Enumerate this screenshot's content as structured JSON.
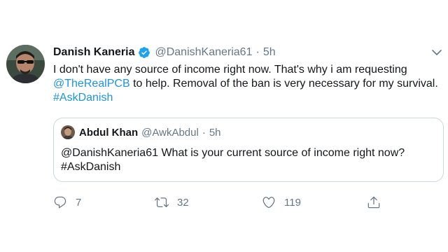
{
  "tweet": {
    "author_name": "Danish Kaneria",
    "author_handle": "@DanishKaneria61",
    "separator": "·",
    "time": "5h",
    "text_line1": "I don't have any source of income right now. That's why i am requesting",
    "mention": "@TheRealPCB",
    "text_line2_rest": " to help. Removal of the ban is very necessary for my survival.",
    "hashtag": "#AskDanish",
    "icons": {
      "verified": "verified-icon",
      "more": "chevron-down-icon",
      "reply": "reply-icon",
      "retweet": "retweet-icon",
      "like": "heart-icon",
      "share": "share-icon"
    },
    "colors": {
      "link": "#1b95e0",
      "muted": "#657786",
      "text": "#14171a",
      "border": "#ccd6dd"
    }
  },
  "quoted": {
    "author_name": "Abdul Khan",
    "author_handle": "@AwkAbdul",
    "separator": "·",
    "time": "5h",
    "text_line1": "@DanishKaneria61 What is your current source of income right now?",
    "text_line2": "#AskDanish"
  },
  "actions": {
    "replies": "7",
    "retweets": "32",
    "likes": "119"
  }
}
